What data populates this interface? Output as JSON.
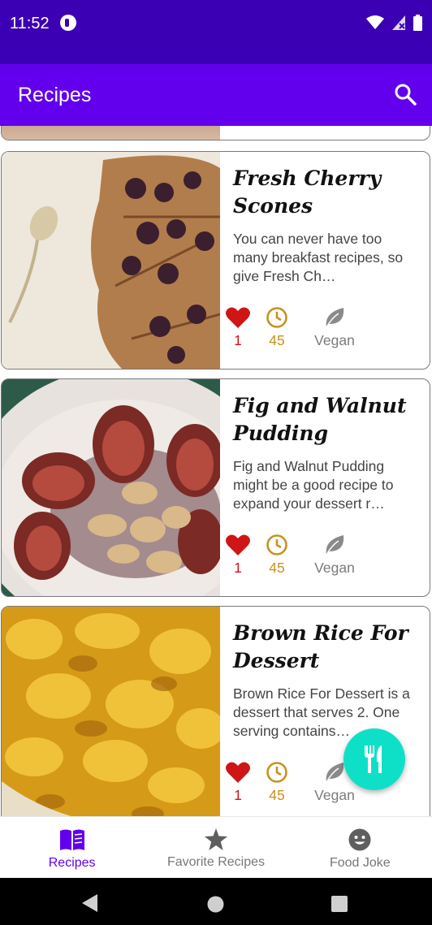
{
  "status_bar": {
    "time": "11:52"
  },
  "app_bar": {
    "title": "Recipes"
  },
  "recipes": [
    {
      "title": "Fresh Cherry Scones",
      "description": "You can never have too many breakfast recipes, so give Fresh Ch…",
      "likes": "1",
      "minutes": "45",
      "diet": "Vegan"
    },
    {
      "title": "Fig and Walnut Pudding",
      "description": "Fig and Walnut Pudding might be a good recipe to expand your dessert r…",
      "likes": "1",
      "minutes": "45",
      "diet": "Vegan"
    },
    {
      "title": "Brown Rice For Dessert",
      "description": "Brown Rice For Dessert is a dessert that serves 2. One serving contains…",
      "likes": "1",
      "minutes": "45",
      "diet": "Vegan"
    }
  ],
  "bottom_nav": {
    "items": [
      {
        "label": "Recipes",
        "icon": "menu-book-icon",
        "active": true
      },
      {
        "label": "Favorite Recipes",
        "icon": "star-icon",
        "active": false
      },
      {
        "label": "Food Joke",
        "icon": "smiley-icon",
        "active": false
      }
    ]
  },
  "colors": {
    "status_bar": "#3b00b3",
    "primary": "#6200ee",
    "fab": "#0ee0c8",
    "heart": "#cf1515",
    "clock": "#c8911f",
    "leaf": "#7b7b7b"
  }
}
